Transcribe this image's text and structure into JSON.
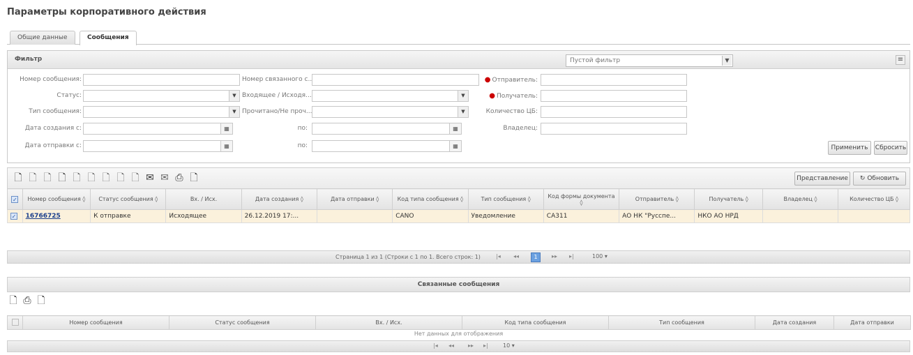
{
  "page_title": "Параметры корпоративного действия",
  "tabs": [
    {
      "label": "Общие данные",
      "active": false
    },
    {
      "label": "Сообщения",
      "active": true
    }
  ],
  "filter": {
    "title": "Фильтр",
    "preset_value": "Пустой фильтр",
    "fields": {
      "msg_number": "Номер сообщения:",
      "status": "Статус:",
      "msg_type": "Тип сообщения:",
      "created_from": "Дата создания с:",
      "sent_from": "Дата отправки с:",
      "related_number": "Номер связанного с...",
      "in_out": "Входящее / Исходя...",
      "read_unread": "Прочитано/Не проч...",
      "to1": "по:",
      "to2": "по:",
      "sender": "Отправитель:",
      "receiver": "Получатель:",
      "qty_cb": "Количество ЦБ:",
      "owner": "Владелец:"
    },
    "apply_label": "Применить",
    "reset_label": "Сбросить"
  },
  "toolbar": {
    "view_label": "Представление",
    "refresh_label": "Обновить"
  },
  "grid": {
    "columns": [
      "Номер сообщения ◊",
      "Статус сообщения ◊",
      "Вх. / Исх.",
      "Дата создания ◊",
      "Дата отправки ◊",
      "Код типа сообщения ◊",
      "Тип сообщения ◊",
      "Код формы документа ◊",
      "Отправитель ◊",
      "Получатель ◊",
      "Владелец ◊",
      "Количество ЦБ ◊"
    ],
    "rows": [
      [
        "16766725",
        "К отправке",
        "Исходящее",
        "26.12.2019 17:...",
        "",
        "CANO",
        "Уведомление",
        "CA311",
        "АО НК \"Русспе...",
        "НКО АО НРД",
        "",
        ""
      ]
    ]
  },
  "pager": {
    "text": "Страница 1 из 1 (Строки с 1 по 1. Всего строк: 1)",
    "current_page": "1",
    "page_size": "100 ▾"
  },
  "related": {
    "title": "Связанные сообщения",
    "columns": [
      "Номер сообщения",
      "Статус сообщения",
      "Вх. / Исх.",
      "Код типа сообщения",
      "Тип сообщения",
      "Дата создания",
      "Дата отправки"
    ],
    "empty_text": "Нет данных для отображения",
    "page_size": "10 ▾"
  }
}
